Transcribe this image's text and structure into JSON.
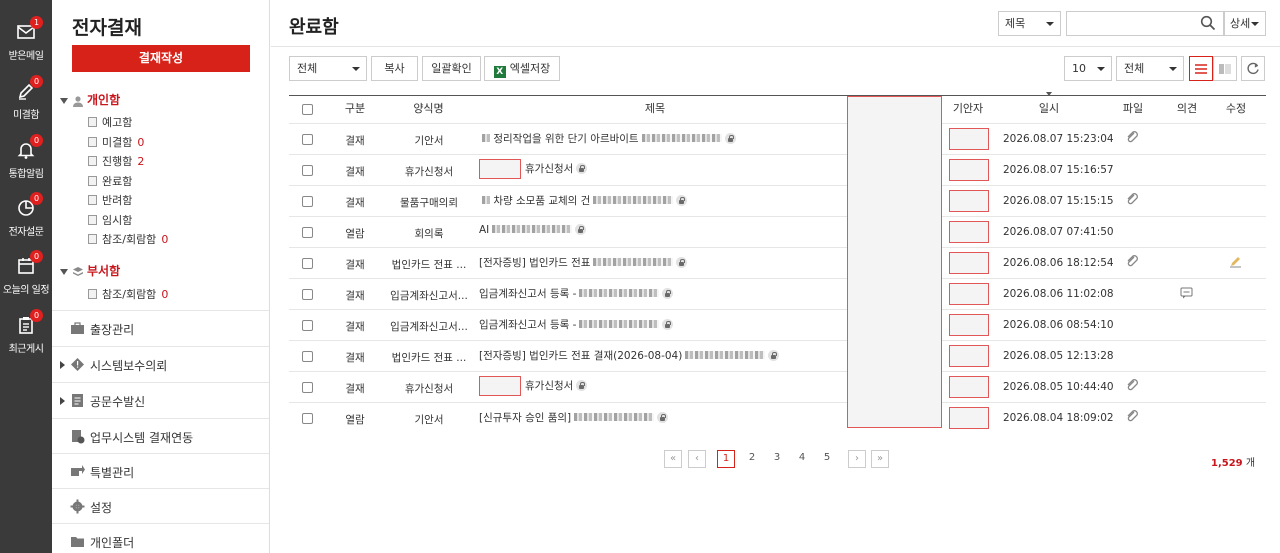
{
  "rail": [
    {
      "label": "받은메일",
      "badge": "1",
      "icon": "mail-icon"
    },
    {
      "label": "미결함",
      "badge": "0",
      "icon": "pen-icon"
    },
    {
      "label": "통합알림",
      "badge": "0",
      "icon": "bell-icon"
    },
    {
      "label": "전자설문",
      "badge": "0",
      "icon": "pie-chart-icon"
    },
    {
      "label": "오늘의 일정",
      "badge": "0",
      "icon": "calendar-icon"
    },
    {
      "label": "최근게시",
      "badge": "0",
      "icon": "clipboard-icon"
    }
  ],
  "sidebar": {
    "title": "전자결재",
    "write_button": "결재작성",
    "personal": {
      "label": "개인함",
      "items": [
        {
          "label": "예고함",
          "count": ""
        },
        {
          "label": "미결함",
          "count": "0"
        },
        {
          "label": "진행함",
          "count": "2"
        },
        {
          "label": "완료함",
          "count": ""
        },
        {
          "label": "반려함",
          "count": ""
        },
        {
          "label": "임시함",
          "count": ""
        },
        {
          "label": "참조/회람함",
          "count": "0"
        }
      ]
    },
    "dept": {
      "label": "부서함",
      "items": [
        {
          "label": "참조/회람함",
          "count": "0"
        }
      ]
    },
    "menus": [
      {
        "label": "출장관리",
        "icon": "briefcase-icon",
        "arrow": false
      },
      {
        "label": "시스템보수의뢰",
        "icon": "diamond-alert-icon",
        "arrow": true
      },
      {
        "label": "공문수발신",
        "icon": "document-icon",
        "arrow": true
      },
      {
        "label": "업무시스템 결재연동",
        "icon": "doc-link-icon",
        "arrow": false
      },
      {
        "label": "특별관리",
        "icon": "export-icon",
        "arrow": false
      },
      {
        "label": "설정",
        "icon": "gear-icon",
        "arrow": false
      },
      {
        "label": "개인폴더",
        "icon": "folder-icon",
        "arrow": false
      }
    ]
  },
  "main": {
    "title": "완료함",
    "search_field": "제목",
    "search_placeholder": "",
    "detail_button": "상세",
    "filter_all": "전체",
    "copy_button": "복사",
    "bulk_confirm_button": "일괄확인",
    "excel_button": "엑셀저장",
    "page_size": "10",
    "view_filter": "전체"
  },
  "table": {
    "headers": {
      "type": "구분",
      "form": "양식명",
      "title": "제목",
      "drafter": "기안자",
      "date": "일시",
      "file": "파일",
      "opinion": "의견",
      "edit": "수정"
    },
    "rows": [
      {
        "type": "결재",
        "form": "기안서",
        "title": "정리작업을 위한 단기 아르바이트",
        "date": "2026.08.07 15:23:04",
        "file": true,
        "opinion": false,
        "edit": false,
        "prefix": true,
        "pre_redact": false
      },
      {
        "type": "결재",
        "form": "휴가신청서",
        "title": "휴가신청서",
        "date": "2026.08.07 15:16:57",
        "file": false,
        "opinion": false,
        "edit": false,
        "prefix": false,
        "pre_redact": true
      },
      {
        "type": "결재",
        "form": "물품구매의뢰",
        "title": "차량 소모품 교체의 건",
        "date": "2026.08.07 15:15:15",
        "file": true,
        "opinion": false,
        "edit": false,
        "prefix": true,
        "pre_redact": false
      },
      {
        "type": "열람",
        "form": "회의록",
        "title": "AI",
        "date": "2026.08.07 07:41:50",
        "file": false,
        "opinion": false,
        "edit": false,
        "prefix": false,
        "pre_redact": false
      },
      {
        "type": "결재",
        "form": "법인카드 전표 ...",
        "title": "[전자증빙] 법인카드 전표",
        "date": "2026.08.06 18:12:54",
        "file": true,
        "opinion": false,
        "edit": true,
        "prefix": false,
        "pre_redact": false
      },
      {
        "type": "결재",
        "form": "입금계좌신고서...",
        "title": "입금계좌신고서 등록 -",
        "date": "2026.08.06 11:02:08",
        "file": false,
        "opinion": true,
        "edit": false,
        "prefix": false,
        "pre_redact": false
      },
      {
        "type": "결재",
        "form": "입금계좌신고서...",
        "title": "입금계좌신고서 등록 -",
        "date": "2026.08.06 08:54:10",
        "file": false,
        "opinion": false,
        "edit": false,
        "prefix": false,
        "pre_redact": false
      },
      {
        "type": "결재",
        "form": "법인카드 전표 ...",
        "title": "[전자증빙] 법인카드 전표 결재(2026-08-04)",
        "date": "2026.08.05 12:13:28",
        "file": false,
        "opinion": false,
        "edit": false,
        "prefix": false,
        "pre_redact": false
      },
      {
        "type": "결재",
        "form": "휴가신청서",
        "title": "휴가신청서",
        "date": "2026.08.05 10:44:40",
        "file": true,
        "opinion": false,
        "edit": false,
        "prefix": false,
        "pre_redact": true
      },
      {
        "type": "열람",
        "form": "기안서",
        "title": "[신규투자 승인 품의]",
        "date": "2026.08.04 18:09:02",
        "file": true,
        "opinion": false,
        "edit": false,
        "prefix": false,
        "pre_redact": false
      }
    ]
  },
  "pager": {
    "pages": [
      "1",
      "2",
      "3",
      "4",
      "5"
    ],
    "current": "1",
    "first": "«",
    "prev": "‹",
    "next": "›",
    "last": "»",
    "total_count": "1,529",
    "total_unit": "개"
  }
}
